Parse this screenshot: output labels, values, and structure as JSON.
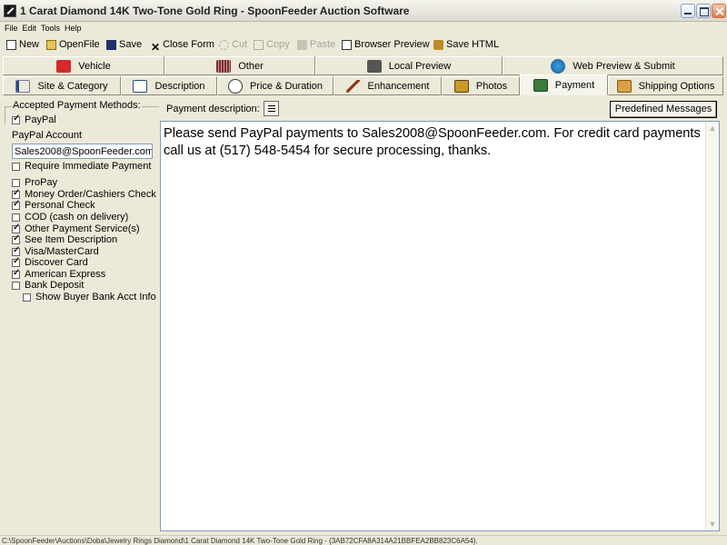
{
  "window": {
    "title": "1 Carat Diamond 14K Two-Tone Gold Ring - SpoonFeeder Auction Software"
  },
  "menu": [
    "File",
    "Edit",
    "Tools",
    "Help"
  ],
  "toolbar": {
    "new": "New",
    "open": "OpenFile",
    "save": "Save",
    "close": "Close Form",
    "cut": "Cut",
    "copy": "Copy",
    "paste": "Paste",
    "browser_preview": "Browser Preview",
    "save_html": "Save HTML"
  },
  "tabs_row1": [
    "Vehicle",
    "Other",
    "Local Preview",
    "Web Preview & Submit"
  ],
  "tabs_row2": [
    "Site & Category",
    "Description",
    "Price & Duration",
    "Enhancement",
    "Photos",
    "Payment",
    "Shipping Options"
  ],
  "payment": {
    "group_label": "Accepted Payment Methods:",
    "paypal": "PayPal",
    "account_label": "PayPal Account",
    "account_value": "Sales2008@SpoonFeeder.com",
    "require_immediate": "Require Immediate Payment",
    "methods": [
      {
        "label": "ProPay",
        "checked": false
      },
      {
        "label": "Money Order/Cashiers Check",
        "checked": true
      },
      {
        "label": "Personal Check",
        "checked": true
      },
      {
        "label": "COD (cash on delivery)",
        "checked": false
      },
      {
        "label": "Other Payment Service(s)",
        "checked": true
      },
      {
        "label": "See Item Description",
        "checked": true
      },
      {
        "label": "Visa/MasterCard",
        "checked": true
      },
      {
        "label": "Discover Card",
        "checked": true
      },
      {
        "label": "American Express",
        "checked": true
      },
      {
        "label": "Bank Deposit",
        "checked": false
      }
    ],
    "show_bank_acct": "Show Buyer Bank Acct Info",
    "description_label": "Payment description:",
    "predefined_button": "Predefined Messages",
    "description_text": "Please send PayPal payments to Sales2008@SpoonFeeder.com.  For credit card payments call us at (517) 548-5454 for secure processing, thanks."
  },
  "status": "C:\\SpoonFeeder\\Auctions\\Doba\\Jewelry Rings Diamond\\1 Carat Diamond 14K Two-Tone Gold Ring - {3AB72CFA8A314A21BBFEA2BB823C6A54}."
}
